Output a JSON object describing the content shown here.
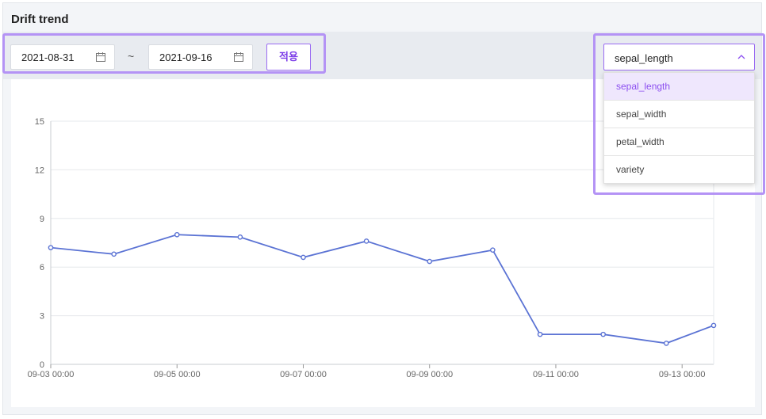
{
  "panel": {
    "title": "Drift trend"
  },
  "filters": {
    "start_date": "2021-08-31",
    "end_date": "2021-09-16",
    "separator": "~",
    "apply_label": "적용",
    "feature_select": {
      "selected": "sepal_length",
      "options": [
        "sepal_length",
        "sepal_width",
        "petal_width",
        "variety"
      ]
    }
  },
  "colors": {
    "accent": "#9a6bf2",
    "line": "#5b73d4"
  },
  "chart_data": {
    "type": "line",
    "ylim": [
      0,
      15
    ],
    "yticks": [
      "0",
      "3",
      "6",
      "9",
      "12",
      "15"
    ],
    "xticks": [
      "09-03 00:00",
      "09-05 00:00",
      "09-07 00:00",
      "09-09 00:00",
      "09-11 00:00",
      "09-13 00:00"
    ],
    "xlim": [
      "2021-09-03 00:00",
      "2021-09-13 12:00"
    ],
    "grid": true,
    "series": [
      {
        "x": [
          "2021-09-03 00:00",
          "2021-09-04 00:00",
          "2021-09-05 00:00",
          "2021-09-06 00:00",
          "2021-09-07 00:00",
          "2021-09-08 00:00",
          "2021-09-09 00:00",
          "2021-09-10 00:00",
          "2021-09-10 18:00",
          "2021-09-11 18:00",
          "2021-09-12 18:00",
          "2021-09-13 12:00"
        ],
        "values": [
          7.2,
          6.8,
          8.0,
          7.85,
          6.6,
          7.6,
          6.35,
          7.05,
          1.85,
          1.85,
          1.3,
          2.4
        ]
      }
    ]
  }
}
